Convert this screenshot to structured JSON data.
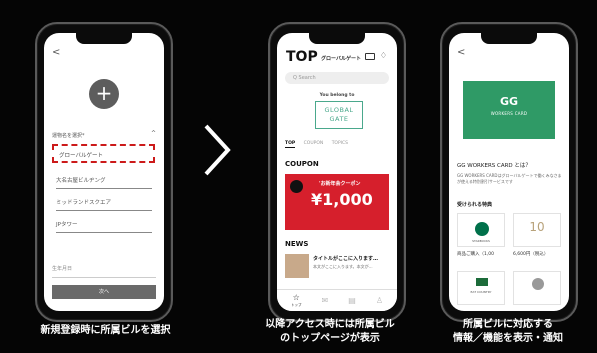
{
  "arrow": {
    "icon": "chevron-right-icon"
  },
  "phone1": {
    "back": "<",
    "select_label": "運物名を選択*",
    "select_chevron": "^",
    "options": [
      "グローバルゲート",
      "大名古屋ビルヂング",
      "ミッドランドスクエア",
      "JPタワー"
    ],
    "field_label": "生年月日",
    "next_button": "次へ",
    "caption": "新規登録時に所属ビルを選択"
  },
  "phone2": {
    "title": "TOP",
    "subtitle": "グローバルゲート",
    "search_placeholder": "Q Search",
    "belong": "You belong to",
    "logo_line1": "GLOBAL",
    "logo_line2": "GATE",
    "tabs": [
      "TOP",
      "COUPON",
      "TOPICS"
    ],
    "coupon_heading": "COUPON",
    "coupon_sub": "'お新年会クーポン",
    "coupon_amount": "¥1,000",
    "news_heading": "NEWS",
    "news_title": "タイトルがここに入ります…",
    "news_body": "本文がここに入ります。本文が…",
    "nav": [
      {
        "label": "トップ",
        "icon": "star-icon",
        "active": true
      },
      {
        "label": "",
        "icon": "mail-icon",
        "active": false
      },
      {
        "label": "",
        "icon": "doc-icon",
        "active": false
      },
      {
        "label": "",
        "icon": "user-icon",
        "active": false
      }
    ],
    "caption_line1": "以降アクセス時には所属ビル",
    "caption_line2": "のトップページが表示"
  },
  "phone3": {
    "back": "<",
    "card_title": "GG",
    "card_subtitle": "WORKERS CARD",
    "what_title": "GG WORKERS CARD とは？",
    "what_body": "GG WORKERS CARDはグローバルゲートで働くみなさまが使える特別割引サービスです",
    "perks_heading": "受けられる特典",
    "perk1_brand": "STARBUCKS",
    "perk1_caption": "商品ご購入（1,00",
    "perk2_caption": "6,600円（税込）",
    "perk3_brand": "EAT COUNTRY",
    "perk4_brand": "",
    "caption_line1": "所属ビルに対応する",
    "caption_line2": "情報／機能を表示・通知"
  }
}
